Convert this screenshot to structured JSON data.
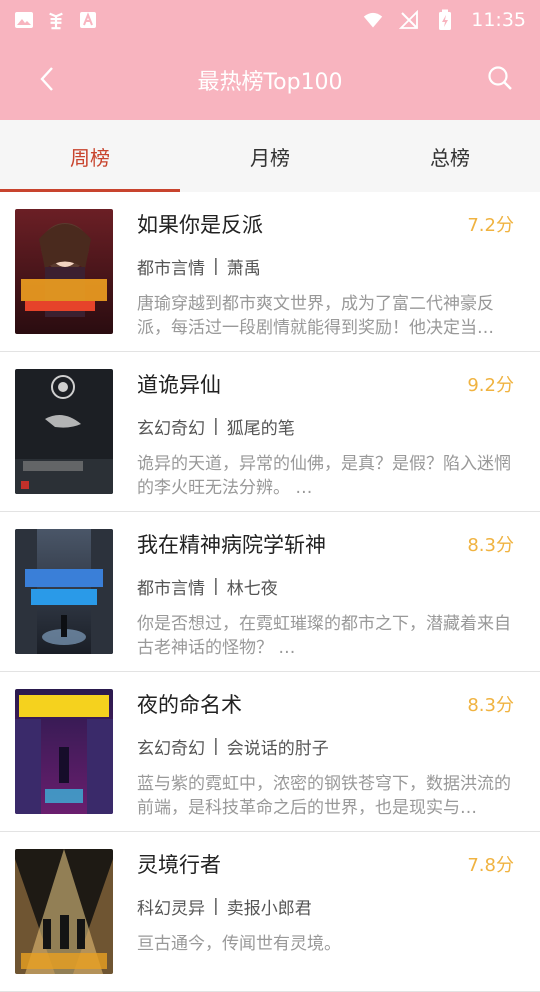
{
  "status_bar": {
    "time": "11:35"
  },
  "appbar": {
    "title": "最热榜Top100"
  },
  "tabs": [
    {
      "label": "周榜"
    },
    {
      "label": "月榜"
    },
    {
      "label": "总榜"
    }
  ],
  "books": [
    {
      "title": "如果你是反派",
      "score": "7.2分",
      "category": "都市言情",
      "author": "萧禹",
      "desc": "唐瑜穿越到都市爽文世界，成为了富二代神豪反派，每活过一段剧情就能得到奖励！他决定当…"
    },
    {
      "title": "道诡异仙",
      "score": "9.2分",
      "category": "玄幻奇幻",
      "author": "狐尾的笔",
      "desc": "诡异的天道，异常的仙佛，是真？是假？陷入迷惘的李火旺无法分辨。 …"
    },
    {
      "title": "我在精神病院学斩神",
      "score": "8.3分",
      "category": "都市言情",
      "author": "林七夜",
      "desc": "你是否想过，在霓虹璀璨的都市之下，潜藏着来自古老神话的怪物？ …"
    },
    {
      "title": "夜的命名术",
      "score": "8.3分",
      "category": "玄幻奇幻",
      "author": "会说话的肘子",
      "desc": "蓝与紫的霓虹中，浓密的钢铁苍穹下，数据洪流的前端，是科技革命之后的世界，也是现实与…"
    },
    {
      "title": "灵境行者",
      "score": "7.8分",
      "category": "科幻灵异",
      "author": "卖报小郎君",
      "desc": "亘古通今，传闻世有灵境。"
    }
  ],
  "colors": {
    "header": "#f8b4bf",
    "tab_active": "#c8442e",
    "score": "#f0b341"
  }
}
